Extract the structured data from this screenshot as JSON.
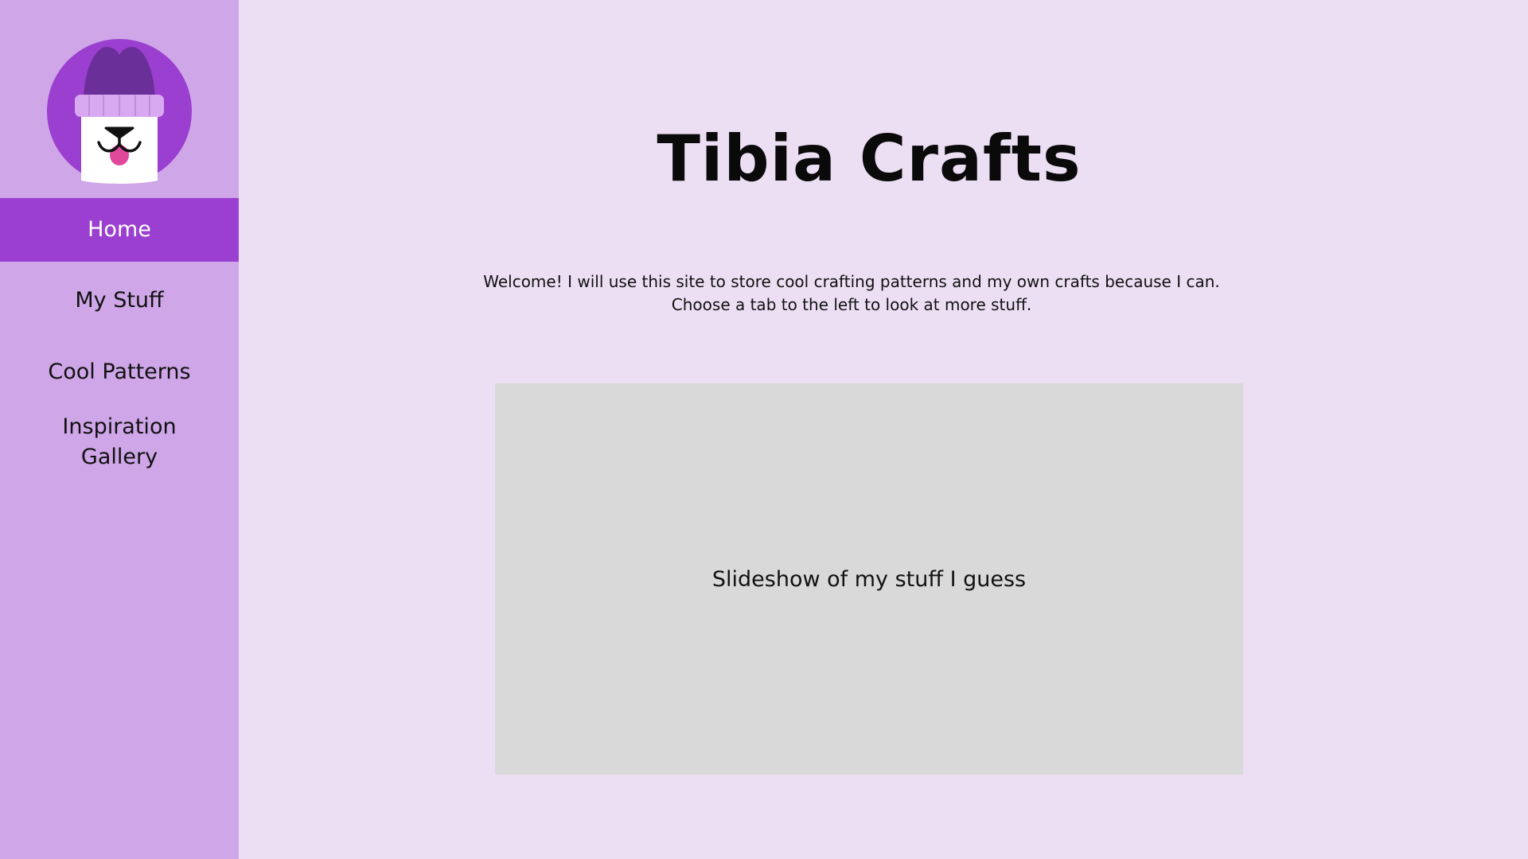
{
  "site": {
    "title": "Tibia Crafts"
  },
  "sidebar": {
    "logo_icon": "dog-with-beanie-icon",
    "items": [
      {
        "label": "Home",
        "active": true
      },
      {
        "label": "My Stuff",
        "active": false
      },
      {
        "label": "Cool Patterns",
        "active": false
      },
      {
        "label": "Inspiration Gallery",
        "active": false
      }
    ]
  },
  "main": {
    "welcome_line1": "Welcome! I will use this site to store cool crafting patterns and my own crafts because I can.",
    "welcome_line2": "Choose a tab to the left to look at more stuff.",
    "slideshow_label": "Slideshow of my stuff I guess"
  },
  "colors": {
    "background": "#ecdff4",
    "sidebar": "#cfa6e8",
    "active_tab": "#9a3fcf",
    "slideshow_placeholder": "#d9d9d9"
  }
}
